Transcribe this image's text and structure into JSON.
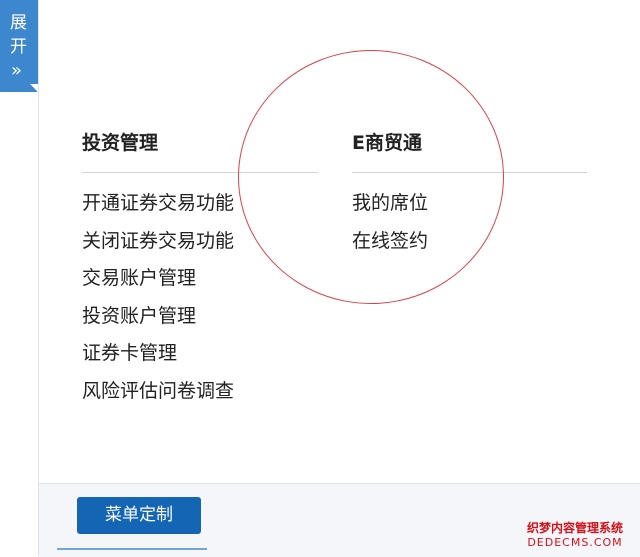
{
  "expand_tab": {
    "line1": "展",
    "line2": "开",
    "chevron": "»"
  },
  "columns": [
    {
      "title": "投资管理",
      "items": [
        "开通证券交易功能",
        "关闭证券交易功能",
        "交易账户管理",
        "投资账户管理",
        "证券卡管理",
        "风险评估问卷调查"
      ]
    },
    {
      "title": "E商贸通",
      "items": [
        "我的席位",
        "在线签约"
      ]
    }
  ],
  "footer": {
    "menu_button": "菜单定制"
  },
  "watermark": {
    "line1": "织梦内容管理系统",
    "line2": "DEDECMS.COM"
  },
  "colors": {
    "accent": "#1466b4",
    "tab": "#3d87cf",
    "annotation": "#d9424b"
  }
}
